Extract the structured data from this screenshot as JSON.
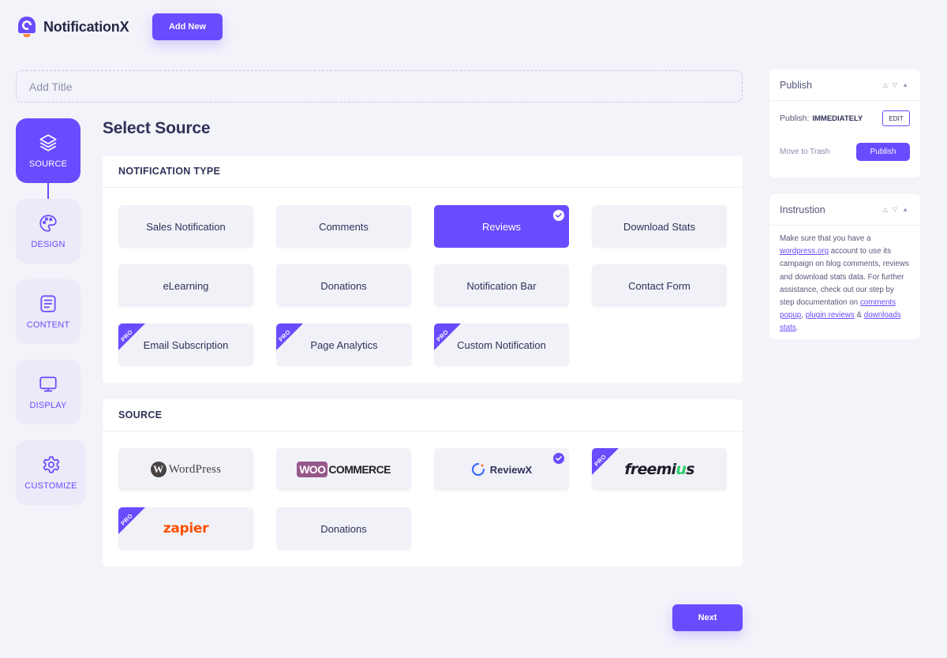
{
  "header": {
    "app_name": "NotificationX",
    "add_new_label": "Add New"
  },
  "title_field": {
    "placeholder": "Add Title",
    "value": ""
  },
  "steps": [
    {
      "label": "SOURCE",
      "icon": "layers-icon",
      "active": true
    },
    {
      "label": "DESIGN",
      "icon": "palette-icon",
      "active": false
    },
    {
      "label": "CONTENT",
      "icon": "document-icon",
      "active": false
    },
    {
      "label": "DISPLAY",
      "icon": "monitor-icon",
      "active": false
    },
    {
      "label": "CUSTOMIZE",
      "icon": "gear-icon",
      "active": false
    }
  ],
  "main": {
    "heading": "Select Source",
    "notification_type": {
      "title": "NOTIFICATION TYPE",
      "items": [
        {
          "label": "Sales Notification"
        },
        {
          "label": "Comments"
        },
        {
          "label": "Reviews",
          "selected": true
        },
        {
          "label": "Download Stats"
        },
        {
          "label": "eLearning"
        },
        {
          "label": "Donations"
        },
        {
          "label": "Notification Bar"
        },
        {
          "label": "Contact Form"
        },
        {
          "label": "Email Subscription",
          "pro": true
        },
        {
          "label": "Page Analytics",
          "pro": true
        },
        {
          "label": "Custom Notification",
          "pro": true
        }
      ]
    },
    "source": {
      "title": "SOURCE",
      "items": [
        {
          "name": "WordPress",
          "logo": "wordpress-logo"
        },
        {
          "name": "WooCommerce",
          "logo": "woocommerce-logo"
        },
        {
          "name": "ReviewX",
          "logo": "reviewx-logo",
          "selected": true
        },
        {
          "name": "freemius",
          "logo": "freemius-logo",
          "pro": true
        },
        {
          "name": "zapier",
          "logo": "zapier-logo",
          "pro": true
        },
        {
          "name": "Donations",
          "logo": ""
        }
      ],
      "logo_text": {
        "wp_w": "W",
        "wp_text": "WordPress",
        "woo": "WOO",
        "commerce": "COMMERCE",
        "reviewx": "ReviewX",
        "freemius_a": "freemi",
        "freemius_b": "u",
        "freemius_c": "s",
        "zapier": "zapier",
        "donations": "Donations"
      }
    },
    "pro_badge": "PRO",
    "next_label": "Next"
  },
  "sidebar": {
    "publish": {
      "title": "Publish",
      "publish_label": "Publish:",
      "publish_value": "IMMEDIATELY",
      "edit_label": "EDIT",
      "trash_label": "Move to Trash",
      "publish_button": "Publish"
    },
    "instruction": {
      "title": "Instrustion",
      "t1": "Make sure that you have a ",
      "link1": "wordpress.org",
      "t2": " account to use its campaign on blog comments, reviews and download stats data. For further assistance, check out our step by step documentation on ",
      "link2": "comments popup",
      "t3": ", ",
      "link3": "plugin reviews",
      "t4": " & ",
      "link4": "downloads stats",
      "t5": "."
    }
  },
  "colors": {
    "accent": "#6a4bff",
    "background": "#f3f3fa",
    "card": "#f1f1f8",
    "woo": "#96588a",
    "zapier": "#ff4f00",
    "freemius_accent": "#2fd06d"
  }
}
